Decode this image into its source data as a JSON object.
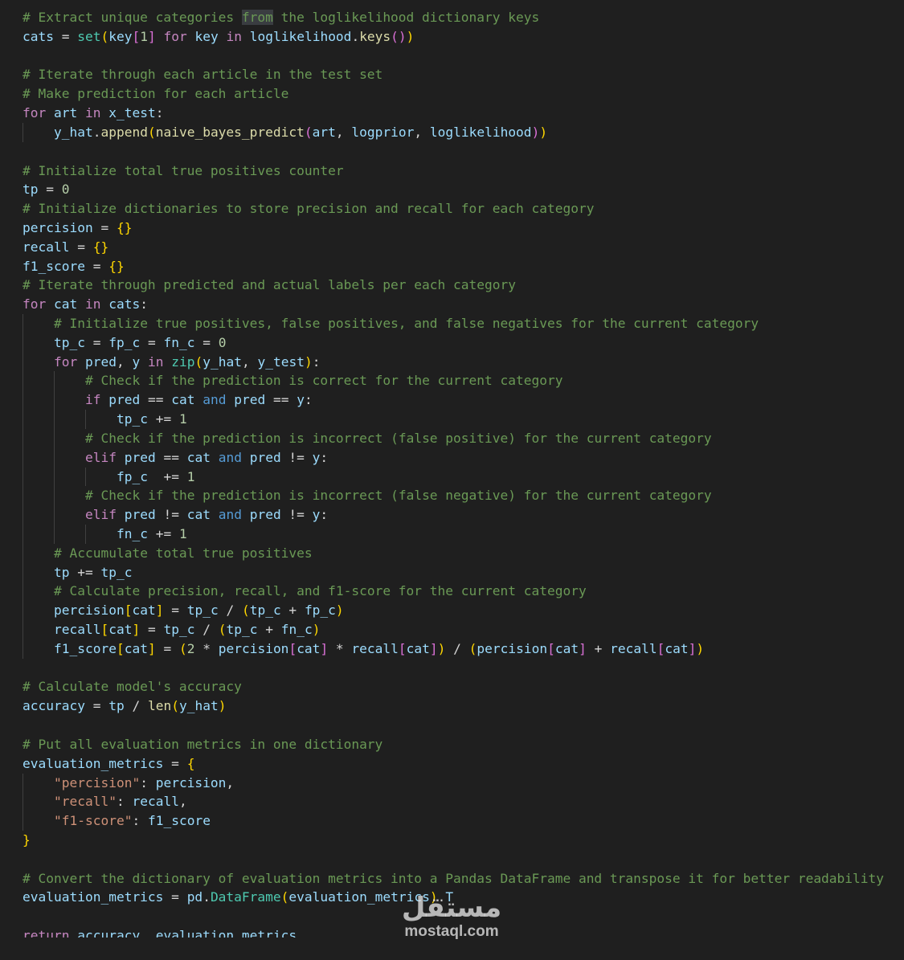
{
  "editor": {
    "theme_colors": {
      "background": "#1f1f1f",
      "comment": "#6a9955",
      "keyword": "#569cd6",
      "control": "#c586c0",
      "function": "#dcdcaa",
      "variable": "#9cdcfe",
      "number": "#b5cea8",
      "string": "#ce9178",
      "class": "#4ec9b0",
      "bracket_1": "#ffd700",
      "bracket_2": "#da70d6",
      "bracket_3": "#179fff"
    },
    "lines": [
      {
        "indent": 0,
        "tokens": [
          [
            "comment",
            "# Extract unique categories "
          ],
          [
            "comment-hl",
            "from"
          ],
          [
            "comment",
            " the loglikelihood dictionary keys"
          ]
        ]
      },
      {
        "indent": 0,
        "tokens": [
          [
            "var",
            "cats"
          ],
          [
            "op",
            " = "
          ],
          [
            "class",
            "set"
          ],
          [
            "b1",
            "("
          ],
          [
            "var",
            "key"
          ],
          [
            "b2",
            "["
          ],
          [
            "number",
            "1"
          ],
          [
            "b2",
            "]"
          ],
          [
            "op",
            " "
          ],
          [
            "control",
            "for"
          ],
          [
            "op",
            " "
          ],
          [
            "var",
            "key"
          ],
          [
            "op",
            " "
          ],
          [
            "control",
            "in"
          ],
          [
            "op",
            " "
          ],
          [
            "var",
            "loglikelihood"
          ],
          [
            "op",
            "."
          ],
          [
            "func",
            "keys"
          ],
          [
            "b2",
            "()"
          ],
          [
            "b1",
            ")"
          ]
        ]
      },
      {
        "indent": 0,
        "tokens": []
      },
      {
        "indent": 0,
        "tokens": [
          [
            "comment",
            "# Iterate through each article in the test set"
          ]
        ]
      },
      {
        "indent": 0,
        "tokens": [
          [
            "comment",
            "# Make prediction for each article"
          ]
        ]
      },
      {
        "indent": 0,
        "tokens": [
          [
            "control",
            "for"
          ],
          [
            "op",
            " "
          ],
          [
            "var",
            "art"
          ],
          [
            "op",
            " "
          ],
          [
            "control",
            "in"
          ],
          [
            "op",
            " "
          ],
          [
            "var",
            "x_test"
          ],
          [
            "op",
            ":"
          ]
        ]
      },
      {
        "indent": 1,
        "tokens": [
          [
            "var",
            "y_hat"
          ],
          [
            "op",
            "."
          ],
          [
            "func",
            "append"
          ],
          [
            "b1",
            "("
          ],
          [
            "func",
            "naive_bayes_predict"
          ],
          [
            "b2",
            "("
          ],
          [
            "var",
            "art"
          ],
          [
            "op",
            ", "
          ],
          [
            "var",
            "logprior"
          ],
          [
            "op",
            ", "
          ],
          [
            "var",
            "loglikelihood"
          ],
          [
            "b2",
            ")"
          ],
          [
            "b1",
            ")"
          ]
        ]
      },
      {
        "indent": 0,
        "tokens": []
      },
      {
        "indent": 0,
        "tokens": [
          [
            "comment",
            "# Initialize total true positives counter"
          ]
        ]
      },
      {
        "indent": 0,
        "tokens": [
          [
            "var",
            "tp"
          ],
          [
            "op",
            " = "
          ],
          [
            "number",
            "0"
          ]
        ]
      },
      {
        "indent": 0,
        "tokens": [
          [
            "comment",
            "# Initialize dictionaries to store precision and recall for each category"
          ]
        ]
      },
      {
        "indent": 0,
        "tokens": [
          [
            "var",
            "percision"
          ],
          [
            "op",
            " = "
          ],
          [
            "b1",
            "{}"
          ]
        ]
      },
      {
        "indent": 0,
        "tokens": [
          [
            "var",
            "recall"
          ],
          [
            "op",
            " = "
          ],
          [
            "b1",
            "{}"
          ]
        ]
      },
      {
        "indent": 0,
        "tokens": [
          [
            "var",
            "f1_score"
          ],
          [
            "op",
            " = "
          ],
          [
            "b1",
            "{}"
          ]
        ]
      },
      {
        "indent": 0,
        "tokens": [
          [
            "comment",
            "# Iterate through predicted and actual labels per each category"
          ]
        ]
      },
      {
        "indent": 0,
        "tokens": [
          [
            "control",
            "for"
          ],
          [
            "op",
            " "
          ],
          [
            "var",
            "cat"
          ],
          [
            "op",
            " "
          ],
          [
            "control",
            "in"
          ],
          [
            "op",
            " "
          ],
          [
            "var",
            "cats"
          ],
          [
            "op",
            ":"
          ]
        ]
      },
      {
        "indent": 1,
        "tokens": [
          [
            "comment",
            "# Initialize true positives, false positives, and false negatives for the current category"
          ]
        ]
      },
      {
        "indent": 1,
        "tokens": [
          [
            "var",
            "tp_c"
          ],
          [
            "op",
            " = "
          ],
          [
            "var",
            "fp_c"
          ],
          [
            "op",
            " = "
          ],
          [
            "var",
            "fn_c"
          ],
          [
            "op",
            " = "
          ],
          [
            "number",
            "0"
          ]
        ]
      },
      {
        "indent": 1,
        "tokens": [
          [
            "control",
            "for"
          ],
          [
            "op",
            " "
          ],
          [
            "var",
            "pred"
          ],
          [
            "op",
            ", "
          ],
          [
            "var",
            "y"
          ],
          [
            "op",
            " "
          ],
          [
            "control",
            "in"
          ],
          [
            "op",
            " "
          ],
          [
            "class",
            "zip"
          ],
          [
            "b1",
            "("
          ],
          [
            "var",
            "y_hat"
          ],
          [
            "op",
            ", "
          ],
          [
            "var",
            "y_test"
          ],
          [
            "b1",
            ")"
          ],
          [
            "op",
            ":"
          ]
        ]
      },
      {
        "indent": 2,
        "tokens": [
          [
            "comment",
            "# Check if the prediction is correct for the current category"
          ]
        ]
      },
      {
        "indent": 2,
        "tokens": [
          [
            "control",
            "if"
          ],
          [
            "op",
            " "
          ],
          [
            "var",
            "pred"
          ],
          [
            "op",
            " == "
          ],
          [
            "var",
            "cat"
          ],
          [
            "op",
            " "
          ],
          [
            "keyword",
            "and"
          ],
          [
            "op",
            " "
          ],
          [
            "var",
            "pred"
          ],
          [
            "op",
            " == "
          ],
          [
            "var",
            "y"
          ],
          [
            "op",
            ":"
          ]
        ]
      },
      {
        "indent": 3,
        "tokens": [
          [
            "var",
            "tp_c"
          ],
          [
            "op",
            " += "
          ],
          [
            "number",
            "1"
          ]
        ]
      },
      {
        "indent": 2,
        "tokens": [
          [
            "comment",
            "# Check if the prediction is incorrect (false positive) for the current category"
          ]
        ]
      },
      {
        "indent": 2,
        "tokens": [
          [
            "control",
            "elif"
          ],
          [
            "op",
            " "
          ],
          [
            "var",
            "pred"
          ],
          [
            "op",
            " == "
          ],
          [
            "var",
            "cat"
          ],
          [
            "op",
            " "
          ],
          [
            "keyword",
            "and"
          ],
          [
            "op",
            " "
          ],
          [
            "var",
            "pred"
          ],
          [
            "op",
            " != "
          ],
          [
            "var",
            "y"
          ],
          [
            "op",
            ":"
          ]
        ]
      },
      {
        "indent": 3,
        "tokens": [
          [
            "var",
            "fp_c"
          ],
          [
            "op",
            "  += "
          ],
          [
            "number",
            "1"
          ]
        ]
      },
      {
        "indent": 2,
        "tokens": [
          [
            "comment",
            "# Check if the prediction is incorrect (false negative) for the current category"
          ]
        ]
      },
      {
        "indent": 2,
        "tokens": [
          [
            "control",
            "elif"
          ],
          [
            "op",
            " "
          ],
          [
            "var",
            "pred"
          ],
          [
            "op",
            " != "
          ],
          [
            "var",
            "cat"
          ],
          [
            "op",
            " "
          ],
          [
            "keyword",
            "and"
          ],
          [
            "op",
            " "
          ],
          [
            "var",
            "pred"
          ],
          [
            "op",
            " != "
          ],
          [
            "var",
            "y"
          ],
          [
            "op",
            ":"
          ]
        ]
      },
      {
        "indent": 3,
        "tokens": [
          [
            "var",
            "fn_c"
          ],
          [
            "op",
            " += "
          ],
          [
            "number",
            "1"
          ]
        ]
      },
      {
        "indent": 1,
        "tokens": [
          [
            "comment",
            "# Accumulate total true positives"
          ]
        ]
      },
      {
        "indent": 1,
        "tokens": [
          [
            "var",
            "tp"
          ],
          [
            "op",
            " += "
          ],
          [
            "var",
            "tp_c"
          ]
        ]
      },
      {
        "indent": 1,
        "tokens": [
          [
            "comment",
            "# Calculate precision, recall, and f1-score for the current category"
          ]
        ]
      },
      {
        "indent": 1,
        "tokens": [
          [
            "var",
            "percision"
          ],
          [
            "b1",
            "["
          ],
          [
            "var",
            "cat"
          ],
          [
            "b1",
            "]"
          ],
          [
            "op",
            " = "
          ],
          [
            "var",
            "tp_c"
          ],
          [
            "op",
            " / "
          ],
          [
            "b1",
            "("
          ],
          [
            "var",
            "tp_c"
          ],
          [
            "op",
            " + "
          ],
          [
            "var",
            "fp_c"
          ],
          [
            "b1",
            ")"
          ]
        ]
      },
      {
        "indent": 1,
        "tokens": [
          [
            "var",
            "recall"
          ],
          [
            "b1",
            "["
          ],
          [
            "var",
            "cat"
          ],
          [
            "b1",
            "]"
          ],
          [
            "op",
            " = "
          ],
          [
            "var",
            "tp_c"
          ],
          [
            "op",
            " / "
          ],
          [
            "b1",
            "("
          ],
          [
            "var",
            "tp_c"
          ],
          [
            "op",
            " + "
          ],
          [
            "var",
            "fn_c"
          ],
          [
            "b1",
            ")"
          ]
        ]
      },
      {
        "indent": 1,
        "tokens": [
          [
            "var",
            "f1_score"
          ],
          [
            "b1",
            "["
          ],
          [
            "var",
            "cat"
          ],
          [
            "b1",
            "]"
          ],
          [
            "op",
            " = "
          ],
          [
            "b1",
            "("
          ],
          [
            "number",
            "2"
          ],
          [
            "op",
            " * "
          ],
          [
            "var",
            "percision"
          ],
          [
            "b2",
            "["
          ],
          [
            "var",
            "cat"
          ],
          [
            "b2",
            "]"
          ],
          [
            "op",
            " * "
          ],
          [
            "var",
            "recall"
          ],
          [
            "b2",
            "["
          ],
          [
            "var",
            "cat"
          ],
          [
            "b2",
            "]"
          ],
          [
            "b1",
            ")"
          ],
          [
            "op",
            " / "
          ],
          [
            "b1",
            "("
          ],
          [
            "var",
            "percision"
          ],
          [
            "b2",
            "["
          ],
          [
            "var",
            "cat"
          ],
          [
            "b2",
            "]"
          ],
          [
            "op",
            " + "
          ],
          [
            "var",
            "recall"
          ],
          [
            "b2",
            "["
          ],
          [
            "var",
            "cat"
          ],
          [
            "b2",
            "]"
          ],
          [
            "b1",
            ")"
          ]
        ]
      },
      {
        "indent": 0,
        "tokens": []
      },
      {
        "indent": 0,
        "tokens": [
          [
            "comment",
            "# Calculate model's accuracy"
          ]
        ]
      },
      {
        "indent": 0,
        "tokens": [
          [
            "var",
            "accuracy"
          ],
          [
            "op",
            " = "
          ],
          [
            "var",
            "tp"
          ],
          [
            "op",
            " / "
          ],
          [
            "func",
            "len"
          ],
          [
            "b1",
            "("
          ],
          [
            "var",
            "y_hat"
          ],
          [
            "b1",
            ")"
          ]
        ]
      },
      {
        "indent": 0,
        "tokens": []
      },
      {
        "indent": 0,
        "tokens": [
          [
            "comment",
            "# Put all evaluation metrics in one dictionary"
          ]
        ]
      },
      {
        "indent": 0,
        "tokens": [
          [
            "var",
            "evaluation_metrics"
          ],
          [
            "op",
            " = "
          ],
          [
            "b1",
            "{"
          ]
        ]
      },
      {
        "indent": 1,
        "tokens": [
          [
            "string",
            "\"percision\""
          ],
          [
            "op",
            ": "
          ],
          [
            "var",
            "percision"
          ],
          [
            "op",
            ","
          ]
        ]
      },
      {
        "indent": 1,
        "tokens": [
          [
            "string",
            "\"recall\""
          ],
          [
            "op",
            ": "
          ],
          [
            "var",
            "recall"
          ],
          [
            "op",
            ","
          ]
        ]
      },
      {
        "indent": 1,
        "tokens": [
          [
            "string",
            "\"f1-score\""
          ],
          [
            "op",
            ": "
          ],
          [
            "var",
            "f1_score"
          ]
        ]
      },
      {
        "indent": 0,
        "tokens": [
          [
            "b1",
            "}"
          ]
        ]
      },
      {
        "indent": 0,
        "tokens": []
      },
      {
        "indent": 0,
        "tokens": [
          [
            "comment",
            "# Convert the dictionary of evaluation metrics into a Pandas DataFrame and transpose it for better readability"
          ]
        ]
      },
      {
        "indent": 0,
        "tokens": [
          [
            "var",
            "evaluation_metrics"
          ],
          [
            "op",
            " = "
          ],
          [
            "var",
            "pd"
          ],
          [
            "op",
            "."
          ],
          [
            "class",
            "DataFrame"
          ],
          [
            "b1",
            "("
          ],
          [
            "var",
            "evaluation_metrics"
          ],
          [
            "b1",
            ")"
          ],
          [
            "op",
            "."
          ],
          [
            "var",
            "T"
          ]
        ]
      },
      {
        "indent": 0,
        "tokens": []
      },
      {
        "indent": 0,
        "cut": true,
        "tokens": [
          [
            "control",
            "return"
          ],
          [
            "op",
            " "
          ],
          [
            "var",
            "accuracy"
          ],
          [
            "op",
            ", "
          ],
          [
            "var",
            "evaluation_metrics"
          ]
        ]
      }
    ]
  },
  "watermark": {
    "arabic": "مستقل",
    "latin": "mostaql.com"
  }
}
